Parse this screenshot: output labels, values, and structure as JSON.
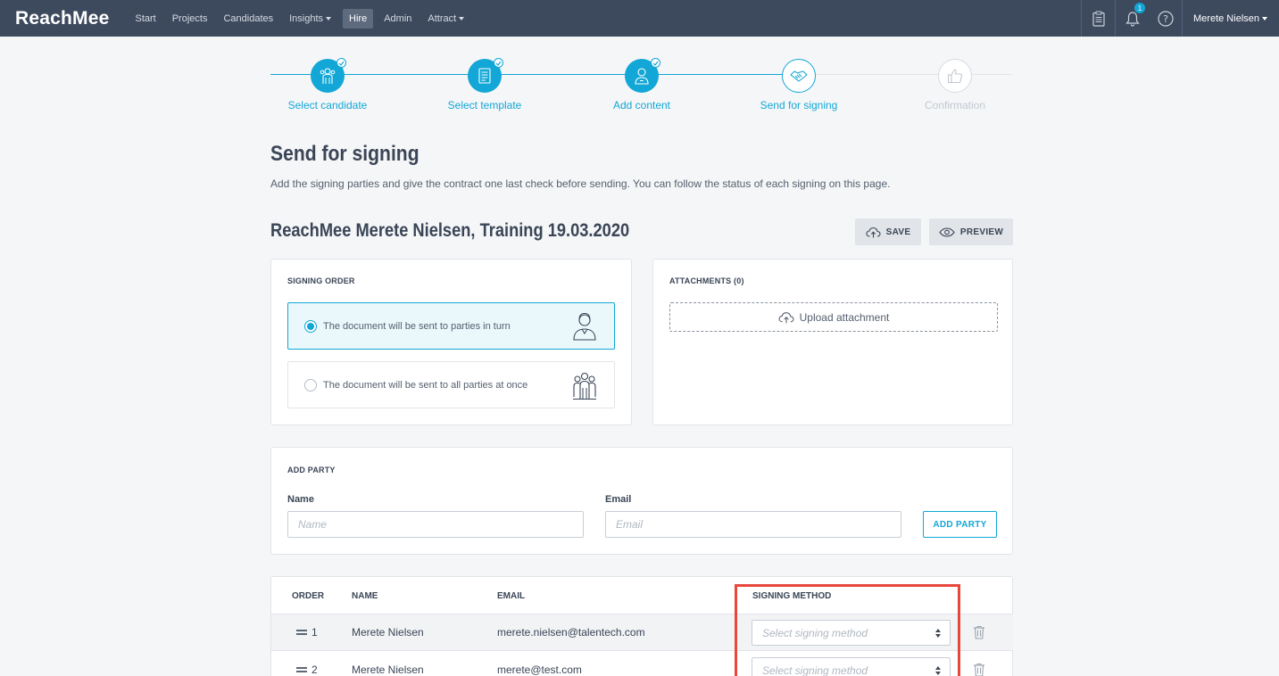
{
  "nav": {
    "logo": "ReachMee",
    "items": [
      {
        "label": "Start",
        "dropdown": false,
        "active": false
      },
      {
        "label": "Projects",
        "dropdown": false,
        "active": false
      },
      {
        "label": "Candidates",
        "dropdown": false,
        "active": false
      },
      {
        "label": "Insights",
        "dropdown": true,
        "active": false
      },
      {
        "label": "Hire",
        "dropdown": false,
        "active": true
      },
      {
        "label": "Admin",
        "dropdown": false,
        "active": false
      },
      {
        "label": "Attract",
        "dropdown": true,
        "active": false
      }
    ],
    "notification_count": "1",
    "user_name": "Merete Nielsen"
  },
  "stepper": {
    "steps": [
      {
        "label": "Select candidate",
        "state": "done"
      },
      {
        "label": "Select template",
        "state": "done"
      },
      {
        "label": "Add content",
        "state": "done"
      },
      {
        "label": "Send for signing",
        "state": "current"
      },
      {
        "label": "Confirmation",
        "state": "future"
      }
    ]
  },
  "page": {
    "title": "Send for signing",
    "description": "Add the signing parties and give the contract one last check before sending. You can follow the status of each signing on this page.",
    "document_title": "ReachMee Merete Nielsen, Training 19.03.2020",
    "save_label": "SAVE",
    "preview_label": "PREVIEW"
  },
  "signing_order": {
    "title": "SIGNING ORDER",
    "option_in_turn": "The document will be sent to parties in turn",
    "option_at_once": "The document will be sent to all parties at once",
    "selected": "in_turn"
  },
  "attachments": {
    "title": "ATTACHMENTS (0)",
    "upload_label": "Upload attachment"
  },
  "add_party": {
    "title": "ADD PARTY",
    "name_label": "Name",
    "name_placeholder": "Name",
    "email_label": "Email",
    "email_placeholder": "Email",
    "button_label": "ADD PARTY"
  },
  "parties_table": {
    "headers": {
      "order": "ORDER",
      "name": "NAME",
      "email": "EMAIL",
      "signing_method": "SIGNING METHOD"
    },
    "rows": [
      {
        "order": "1",
        "name": "Merete Nielsen",
        "email": "merete.nielsen@talentech.com",
        "signing_method_placeholder": "Select signing method"
      },
      {
        "order": "2",
        "name": "Merete Nielsen",
        "email": "merete@test.com",
        "signing_method_placeholder": "Select signing method"
      }
    ]
  },
  "colors": {
    "topbar": "#3d4a5e",
    "accent": "#12a7d6",
    "highlight": "#e8473b"
  }
}
